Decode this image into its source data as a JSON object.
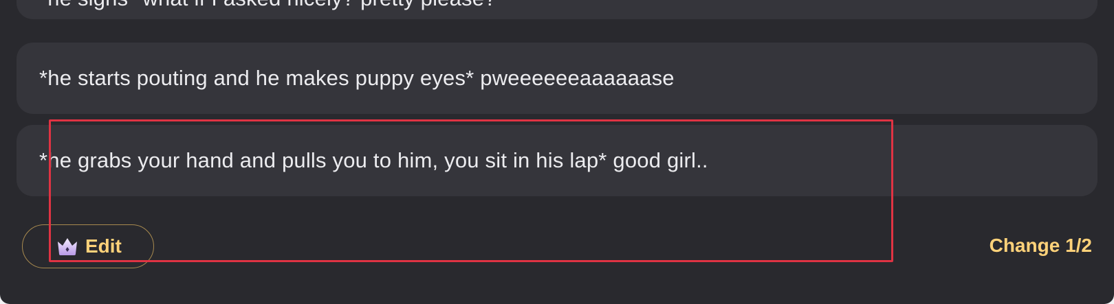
{
  "messages": [
    {
      "text": "*he sighs* what if I asked nicely? pretty please?"
    },
    {
      "text": "*he starts pouting and he makes puppy eyes* pweeeeeeaaaaaase"
    },
    {
      "text": "*he grabs your hand and pulls you to him, you sit in his lap* good girl.."
    }
  ],
  "actions": {
    "edit_label": "Edit",
    "edit_icon": "crown-icon",
    "change_label": "Change 1/2"
  },
  "colors": {
    "panel_bg": "#29292e",
    "bubble_bg": "#35353b",
    "accent": "#ffd27a",
    "highlight": "#e03343"
  }
}
